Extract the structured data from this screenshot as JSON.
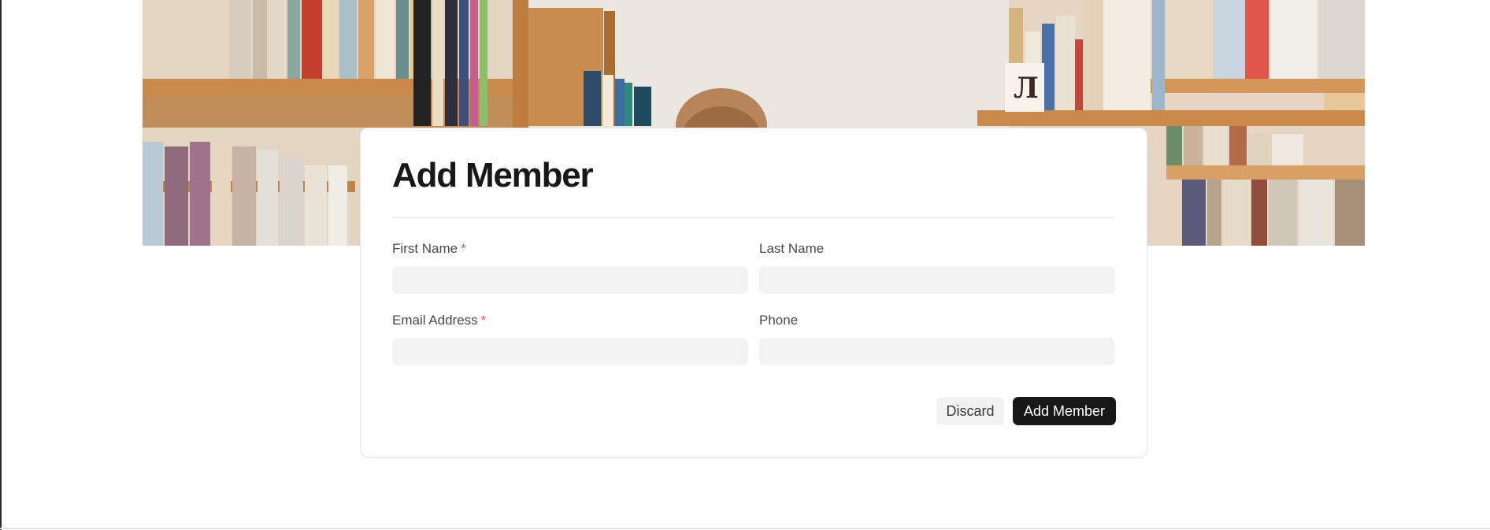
{
  "form": {
    "title": "Add Member",
    "fields": {
      "first_name": {
        "label": "First Name",
        "required_mark": "*",
        "value": ""
      },
      "last_name": {
        "label": "Last Name",
        "value": ""
      },
      "email": {
        "label": "Email Address",
        "required_mark": "*",
        "value": ""
      },
      "phone": {
        "label": "Phone",
        "value": ""
      }
    },
    "buttons": {
      "discard_label": "Discard",
      "submit_label": "Add Member"
    }
  },
  "colors": {
    "primary_button": "#171717",
    "required_mark": "#e05a4e",
    "input_background": "#f3f3f3"
  },
  "hero": {
    "icon": "library-bookshelf-illustration",
    "book_spine_letter": "Л"
  }
}
